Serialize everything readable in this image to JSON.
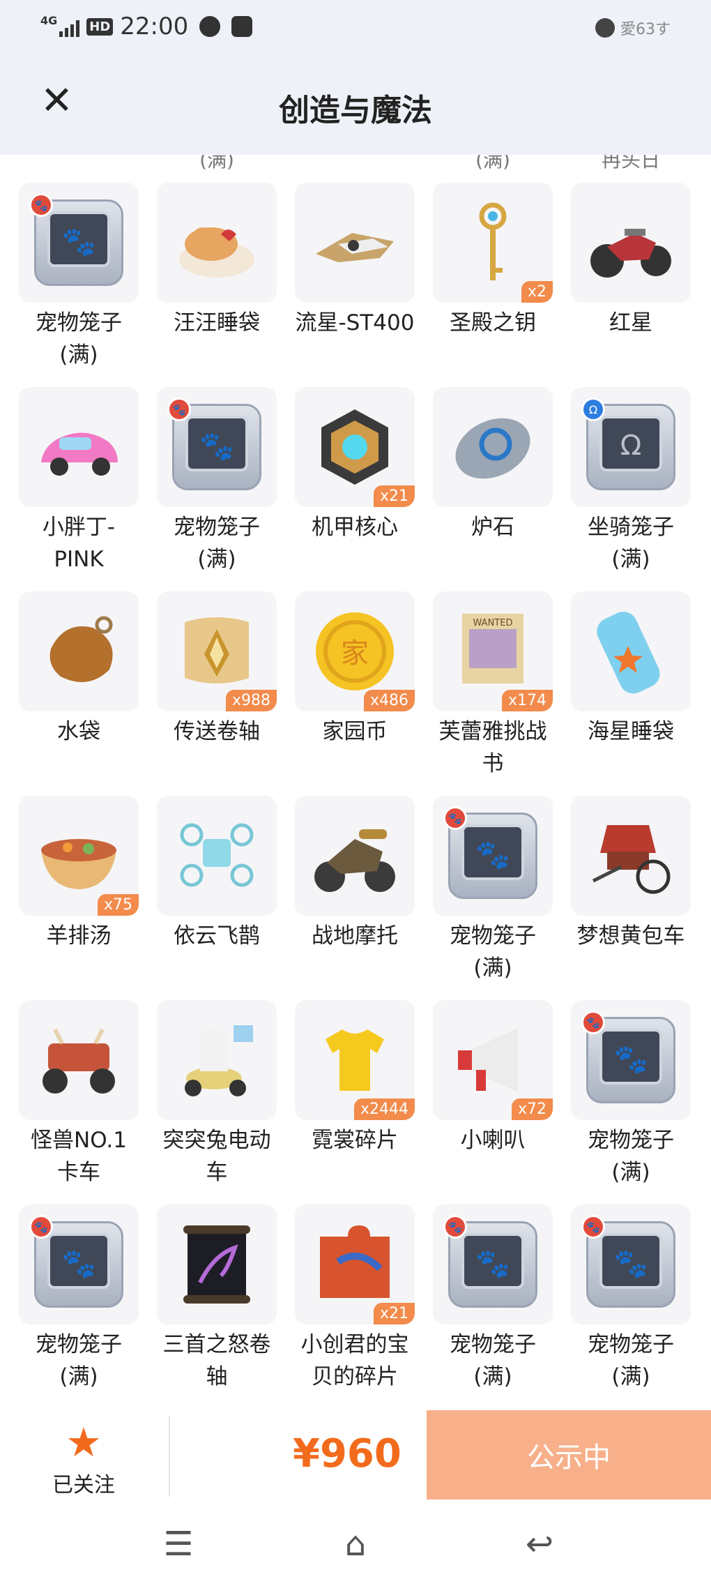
{
  "status_bar": {
    "network": "4G",
    "hd": "HD",
    "time": "22:00",
    "right_text": "愛63す"
  },
  "header": {
    "title": "创造与魔法"
  },
  "partial_top_labels": [
    "(满)",
    "(满)",
    "冉头日"
  ],
  "items": [
    {
      "name": "宠物笼子(满)",
      "badge": "",
      "art": "pet-cage-icon"
    },
    {
      "name": "汪汪睡袋",
      "badge": "",
      "art": "dog-sleeping-bag-icon"
    },
    {
      "name": "流星-ST400",
      "badge": "",
      "art": "spaceship-icon"
    },
    {
      "name": "圣殿之钥",
      "badge": "x2",
      "art": "key-icon"
    },
    {
      "name": "红星",
      "badge": "",
      "art": "motorcycle-icon"
    },
    {
      "name": "小胖丁-PINK",
      "badge": "",
      "art": "pink-car-icon"
    },
    {
      "name": "宠物笼子(满)",
      "badge": "",
      "art": "pet-cage-icon"
    },
    {
      "name": "机甲核心",
      "badge": "x21",
      "art": "mech-core-icon"
    },
    {
      "name": "炉石",
      "badge": "",
      "art": "hearthstone-icon"
    },
    {
      "name": "坐骑笼子(满)",
      "badge": "",
      "art": "mount-cage-icon"
    },
    {
      "name": "水袋",
      "badge": "",
      "art": "water-bag-icon"
    },
    {
      "name": "传送卷轴",
      "badge": "x988",
      "art": "teleport-scroll-icon"
    },
    {
      "name": "家园币",
      "badge": "x486",
      "art": "coin-icon"
    },
    {
      "name": "芙蕾雅挑战书",
      "badge": "x174",
      "art": "wanted-poster-icon"
    },
    {
      "name": "海星睡袋",
      "badge": "",
      "art": "starfish-sleeping-bag-icon"
    },
    {
      "name": "羊排汤",
      "badge": "x75",
      "art": "soup-bowl-icon"
    },
    {
      "name": "依云飞鹊",
      "badge": "",
      "art": "drone-icon"
    },
    {
      "name": "战地摩托",
      "badge": "",
      "art": "battle-motorcycle-icon"
    },
    {
      "name": "宠物笼子(满)",
      "badge": "",
      "art": "pet-cage-icon"
    },
    {
      "name": "梦想黄包车",
      "badge": "",
      "art": "rickshaw-icon"
    },
    {
      "name": "怪兽NO.1卡车",
      "badge": "",
      "art": "monster-truck-icon"
    },
    {
      "name": "突突兔电动车",
      "badge": "",
      "art": "scooter-icon"
    },
    {
      "name": "霓裳碎片",
      "badge": "x2444",
      "art": "tshirt-fragment-icon"
    },
    {
      "name": "小喇叭",
      "badge": "x72",
      "art": "megaphone-icon"
    },
    {
      "name": "宠物笼子(满)",
      "badge": "",
      "art": "pet-cage-icon"
    },
    {
      "name": "宠物笼子(满)",
      "badge": "",
      "art": "pet-cage-icon"
    },
    {
      "name": "三首之怒卷轴",
      "badge": "",
      "art": "dragon-scroll-icon"
    },
    {
      "name": "小创君的宝贝的碎片",
      "badge": "x21",
      "art": "puzzle-piece-icon"
    },
    {
      "name": "宠物笼子(满)",
      "badge": "",
      "art": "pet-cage-icon"
    },
    {
      "name": "宠物笼子(满)",
      "badge": "",
      "art": "pet-cage-icon"
    }
  ],
  "name_lines": [
    [
      "宠物笼子",
      "(满)"
    ],
    [
      "汪汪睡袋"
    ],
    [
      "流星-ST400"
    ],
    [
      "圣殿之钥"
    ],
    [
      "红星"
    ],
    [
      "小胖丁-",
      "PINK"
    ],
    [
      "宠物笼子",
      "(满)"
    ],
    [
      "机甲核心"
    ],
    [
      "炉石"
    ],
    [
      "坐骑笼子",
      "(满)"
    ],
    [
      "水袋"
    ],
    [
      "传送卷轴"
    ],
    [
      "家园币"
    ],
    [
      "芙蕾雅挑战",
      "书"
    ],
    [
      "海星睡袋"
    ],
    [
      "羊排汤"
    ],
    [
      "依云飞鹊"
    ],
    [
      "战地摩托"
    ],
    [
      "宠物笼子",
      "(满)"
    ],
    [
      "梦想黄包车"
    ],
    [
      "怪兽NO.1",
      "卡车"
    ],
    [
      "突突兔电动",
      "车"
    ],
    [
      "霓裳碎片"
    ],
    [
      "小喇叭"
    ],
    [
      "宠物笼子",
      "(满)"
    ],
    [
      "宠物笼子",
      "(满)"
    ],
    [
      "三首之怒卷",
      "轴"
    ],
    [
      "小创君的宝",
      "贝的碎片"
    ],
    [
      "宠物笼子",
      "(满)"
    ],
    [
      "宠物笼子",
      "(满)"
    ]
  ],
  "bottom_bar": {
    "follow_label": "已关注",
    "price": "¥960",
    "cta_label": "公示中"
  },
  "colors": {
    "accent": "#f26b1d",
    "badge": "#f28b4b",
    "cta_bg": "#f8b08a",
    "header_bg": "#eef2f8"
  }
}
